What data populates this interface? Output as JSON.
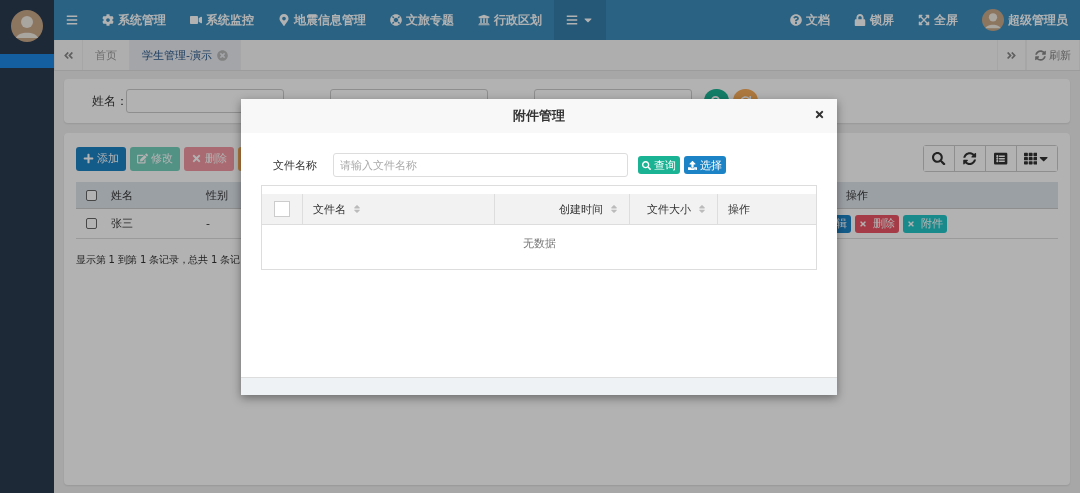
{
  "sidebar": {
    "items": [
      {
        "selected": true
      }
    ]
  },
  "header": {
    "nav": [
      {
        "label": "系统管理"
      },
      {
        "label": "系统监控"
      },
      {
        "label": "地震信息管理"
      },
      {
        "label": "文旅专题"
      },
      {
        "label": "行政区划"
      }
    ],
    "right": [
      {
        "label": "文档"
      },
      {
        "label": "锁屏"
      },
      {
        "label": "全屏"
      }
    ],
    "user": "超级管理员"
  },
  "tabs": [
    {
      "label": "首页",
      "selected": false,
      "closable": false
    },
    {
      "label": "学生管理-演示",
      "selected": true,
      "closable": true
    }
  ],
  "refresh": "刷新",
  "search": {
    "fields": [
      {
        "kind": "labeled",
        "label": "姓名："
      },
      {
        "kind": "input"
      },
      {
        "kind": "input"
      }
    ],
    "buttons": [
      {
        "kind": "search"
      },
      {
        "kind": "reset"
      }
    ]
  },
  "toolbar": [
    {
      "label": "添加",
      "kind": "add",
      "disabled": false
    },
    {
      "label": "修改",
      "kind": "edit",
      "disabled": true
    },
    {
      "label": "删除",
      "kind": "delete",
      "disabled": true
    }
  ],
  "table": {
    "select_all": false,
    "columns": [
      "姓名",
      "性别",
      "操作"
    ],
    "rows": [
      {
        "checked": false,
        "cells": [
          "张三",
          "-"
        ],
        "actions": [
          {
            "label": "辑",
            "kind": "edit",
            "icon_visible": false
          },
          {
            "label": "删除",
            "kind": "delete"
          },
          {
            "label": "附件",
            "kind": "attach"
          }
        ]
      }
    ]
  },
  "pagination": "显示第 1 到第 1 条记录，总共 1 条记",
  "modal": {
    "title": "附件管理",
    "filter_label": "文件名称",
    "placeholder": "请输入文件名称",
    "buttons": [
      {
        "label": "查询",
        "kind": "search"
      },
      {
        "label": "选择",
        "kind": "upload"
      }
    ],
    "columns": [
      {
        "label": "文件名",
        "sortable": true
      },
      {
        "label": "创建时间",
        "sortable": true
      },
      {
        "label": "文件大小",
        "sortable": true
      },
      {
        "label": "操作",
        "sortable": false
      }
    ],
    "select_all": false,
    "empty_text": "无数据"
  }
}
